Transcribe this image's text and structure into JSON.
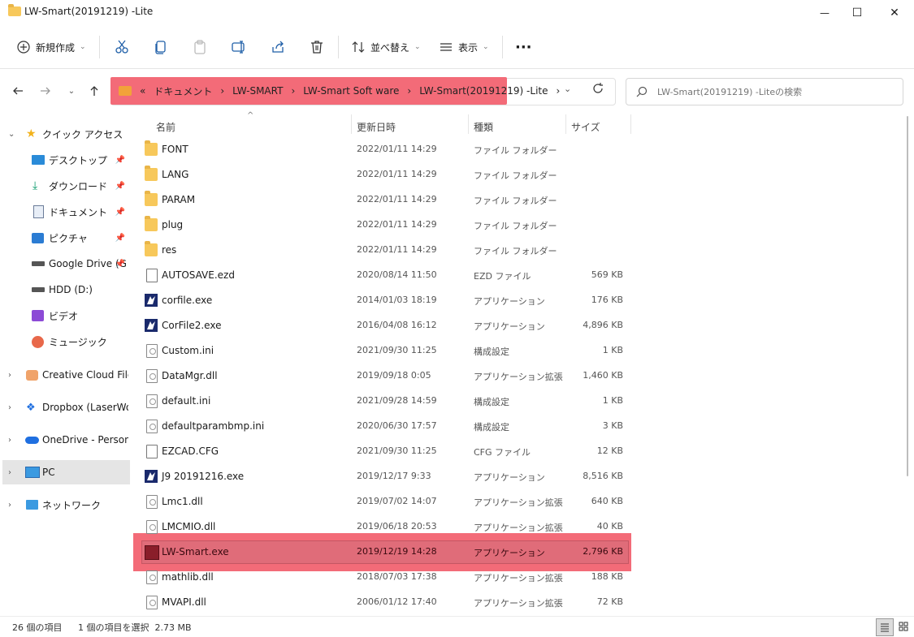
{
  "window": {
    "title": "LW-Smart(20191219) -Lite",
    "minimize_glyph": "—",
    "maximize_glyph": "☐",
    "close_glyph": "✕"
  },
  "toolbar": {
    "new_label": "新規作成",
    "sort_label": "並べ替え",
    "view_label": "表示",
    "more_glyph": "···"
  },
  "address": {
    "overflow": "«",
    "crumbs": [
      "ドキュメント",
      "LW-SMART",
      "LW-Smart Soft ware",
      "LW-Smart(20191219) -Lite"
    ],
    "separator": "›"
  },
  "search": {
    "placeholder": "LW-Smart(20191219) -Liteの検索"
  },
  "sidebar": {
    "items": [
      {
        "label": "クイック アクセス",
        "icon": "star-icon"
      },
      {
        "label": "デスクトップ",
        "icon": "desktop-icon",
        "pinned": true
      },
      {
        "label": "ダウンロード",
        "icon": "download-icon",
        "pinned": true
      },
      {
        "label": "ドキュメント",
        "icon": "document-icon",
        "pinned": true
      },
      {
        "label": "ピクチャ",
        "icon": "picture-icon",
        "pinned": true
      },
      {
        "label": "Google Drive (G",
        "icon": "drive-icon",
        "pinned": true
      },
      {
        "label": "HDD (D:)",
        "icon": "drive-icon"
      },
      {
        "label": "ビデオ",
        "icon": "video-icon"
      },
      {
        "label": "ミュージック",
        "icon": "music-icon"
      },
      {
        "label": "Creative Cloud Files",
        "icon": "creative-cloud-icon"
      },
      {
        "label": "Dropbox (LaserWork",
        "icon": "dropbox-icon"
      },
      {
        "label": "OneDrive - Personal",
        "icon": "onedrive-icon"
      },
      {
        "label": "PC",
        "icon": "pc-icon"
      },
      {
        "label": "ネットワーク",
        "icon": "network-icon"
      }
    ]
  },
  "columns": {
    "name": "名前",
    "date": "更新日時",
    "type": "種類",
    "size": "サイズ"
  },
  "files": [
    {
      "name": "FONT",
      "date": "2022/01/11 14:29",
      "type": "ファイル フォルダー",
      "size": "",
      "icon": "folder"
    },
    {
      "name": "LANG",
      "date": "2022/01/11 14:29",
      "type": "ファイル フォルダー",
      "size": "",
      "icon": "folder"
    },
    {
      "name": "PARAM",
      "date": "2022/01/11 14:29",
      "type": "ファイル フォルダー",
      "size": "",
      "icon": "folder"
    },
    {
      "name": "plug",
      "date": "2022/01/11 14:29",
      "type": "ファイル フォルダー",
      "size": "",
      "icon": "folder"
    },
    {
      "name": "res",
      "date": "2022/01/11 14:29",
      "type": "ファイル フォルダー",
      "size": "",
      "icon": "folder"
    },
    {
      "name": "AUTOSAVE.ezd",
      "date": "2020/08/14 11:50",
      "type": "EZD ファイル",
      "size": "569 KB",
      "icon": "doc"
    },
    {
      "name": "corfile.exe",
      "date": "2014/01/03 18:19",
      "type": "アプリケーション",
      "size": "176 KB",
      "icon": "exe"
    },
    {
      "name": "CorFile2.exe",
      "date": "2016/04/08 16:12",
      "type": "アプリケーション",
      "size": "4,896 KB",
      "icon": "exe"
    },
    {
      "name": "Custom.ini",
      "date": "2021/09/30 11:25",
      "type": "構成設定",
      "size": "1 KB",
      "icon": "gear"
    },
    {
      "name": "DataMgr.dll",
      "date": "2019/09/18 0:05",
      "type": "アプリケーション拡張",
      "size": "1,460 KB",
      "icon": "gear"
    },
    {
      "name": "default.ini",
      "date": "2021/09/28 14:59",
      "type": "構成設定",
      "size": "1 KB",
      "icon": "gear"
    },
    {
      "name": "defaultparambmp.ini",
      "date": "2020/06/30 17:57",
      "type": "構成設定",
      "size": "3 KB",
      "icon": "gear"
    },
    {
      "name": "EZCAD.CFG",
      "date": "2021/09/30 11:25",
      "type": "CFG ファイル",
      "size": "12 KB",
      "icon": "doc"
    },
    {
      "name": "J9 20191216.exe",
      "date": "2019/12/17 9:33",
      "type": "アプリケーション",
      "size": "8,516 KB",
      "icon": "exe"
    },
    {
      "name": "Lmc1.dll",
      "date": "2019/07/02 14:07",
      "type": "アプリケーション拡張",
      "size": "640 KB",
      "icon": "gear"
    },
    {
      "name": "LMCMIO.dll",
      "date": "2019/06/18 20:53",
      "type": "アプリケーション拡張",
      "size": "40 KB",
      "icon": "gear"
    },
    {
      "name": "LW-Smart.exe",
      "date": "2019/12/19 14:28",
      "type": "アプリケーション",
      "size": "2,796 KB",
      "icon": "lwsmart",
      "highlighted": true
    },
    {
      "name": "mathlib.dll",
      "date": "2018/07/03 17:38",
      "type": "アプリケーション拡張",
      "size": "188 KB",
      "icon": "gear"
    },
    {
      "name": "MVAPI.dll",
      "date": "2006/01/12 17:40",
      "type": "アプリケーション拡張",
      "size": "72 KB",
      "icon": "gear"
    }
  ],
  "status": {
    "count": "26 個の項目",
    "selection": "1 個の項目を選択  2.73 MB"
  },
  "colors": {
    "highlight": "#f36b78",
    "folder": "#f7c85b",
    "accent": "#0067c0"
  }
}
